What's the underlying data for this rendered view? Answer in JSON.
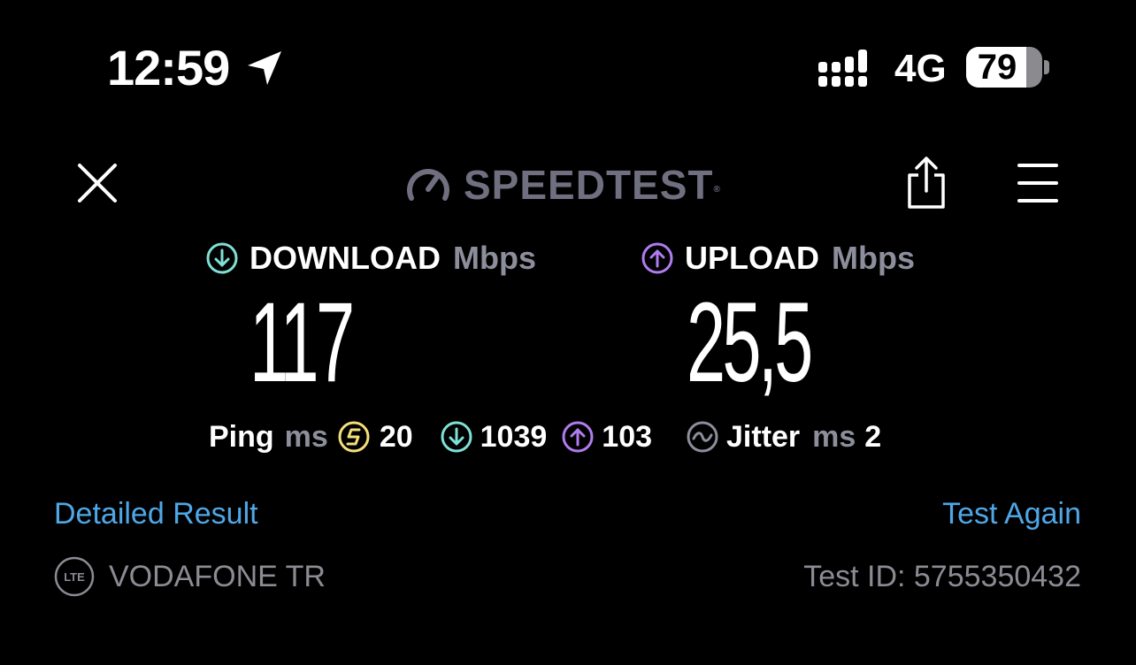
{
  "status_bar": {
    "time": "12:59",
    "network": "4G",
    "battery_percent": "79",
    "battery_level": 0.79,
    "icons": [
      "location-arrow-icon",
      "signal-bars-icon"
    ]
  },
  "header": {
    "logo_text": "SPEEDTEST",
    "logo_tm": "®",
    "icons": [
      "close-icon",
      "speedometer-icon",
      "share-icon",
      "menu-icon"
    ]
  },
  "download": {
    "label": "DOWNLOAD",
    "unit": "Mbps",
    "value": "117",
    "color": "#7fe0d6"
  },
  "upload": {
    "label": "UPLOAD",
    "unit": "Mbps",
    "value": "25,5",
    "color": "#b07cf0"
  },
  "ping": {
    "label": "Ping",
    "unit": "ms",
    "idle_value": "20",
    "idle_color": "#f3e07a",
    "download_value": "1039",
    "upload_value": "103"
  },
  "jitter": {
    "label": "Jitter",
    "unit": "ms",
    "value": "2"
  },
  "links": {
    "detailed_result": "Detailed Result",
    "test_again": "Test Again"
  },
  "footer": {
    "connection_type": "LTE",
    "provider": "VODAFONE TR",
    "test_id": "Test ID: 5755350432"
  },
  "colors": {
    "background": "#000000",
    "link": "#4fa7e6",
    "muted": "#8d8e9c"
  }
}
